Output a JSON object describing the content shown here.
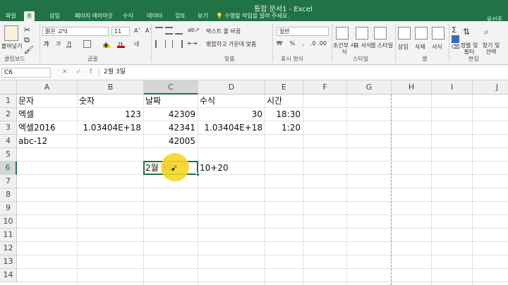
{
  "window": {
    "title": "통합 문서1 - Excel",
    "user": "유선주",
    "tell_me": "수행할 작업을 알려 주세요."
  },
  "tabs": [
    "파일",
    "홈",
    "삽입",
    "페이지 레이아웃",
    "수식",
    "데이터",
    "검토",
    "보기"
  ],
  "active_tab": "홈",
  "ribbon": {
    "clipboard": {
      "paste": "붙여넣기",
      "label": "클립보드"
    },
    "font": {
      "name": "맑은 고딕",
      "size": "11",
      "bold": "가",
      "italic": "가",
      "underline": "가",
      "label": "글꼴"
    },
    "alignment": {
      "wrap": "텍스트 줄 바꿈",
      "merge": "병합하고 가운데 맞춤",
      "label": "맞춤"
    },
    "number": {
      "format": "일반",
      "label": "표시 형식"
    },
    "styles": {
      "conditional": "조건부 서식",
      "table": "표 서식",
      "cell": "셀 스타일",
      "label": "스타일"
    },
    "cells": {
      "insert": "삽입",
      "delete": "삭제",
      "format": "서식",
      "label": "셀"
    },
    "editing": {
      "sort": "정렬 및 필터",
      "find": "찾기 및 선택",
      "label": "편집"
    }
  },
  "formula_bar": {
    "name_box": "C6",
    "content": "2월 3일"
  },
  "columns": [
    "A",
    "B",
    "C",
    "D",
    "E",
    "F",
    "G",
    "H",
    "I",
    "J"
  ],
  "rows": [
    "1",
    "2",
    "3",
    "4",
    "5",
    "6",
    "7",
    "8",
    "9",
    "10",
    "11",
    "12",
    "13",
    "14"
  ],
  "cells": {
    "A1": "문자",
    "B1": "숫자",
    "C1": "날짜",
    "D1": "수식",
    "E1": "시간",
    "A2": "엑셀",
    "B2": "123",
    "C2": "42309",
    "D2": "30",
    "E2": "18:30",
    "A3": "엑셀2016",
    "B3": "1.03404E+18",
    "C3": "42341",
    "D3": "1.03404E+18",
    "E3": "1:20",
    "A4": "abc-12",
    "C4": "42005",
    "C6": "2월 3일",
    "D6": "10+20"
  },
  "selected_cell": "C6",
  "highlight_color": "#f7d51e",
  "accent_color": "#217346"
}
